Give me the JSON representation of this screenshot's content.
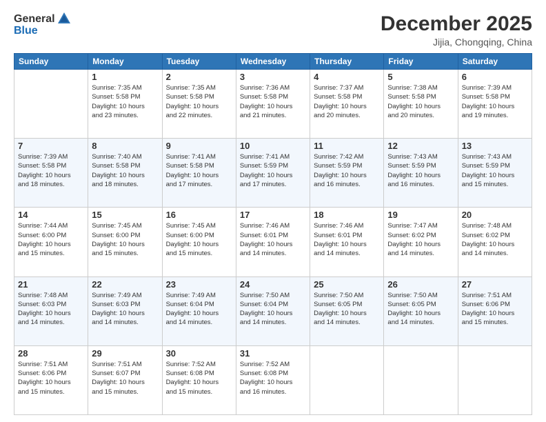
{
  "header": {
    "logo_general": "General",
    "logo_blue": "Blue",
    "month": "December 2025",
    "location": "Jijia, Chongqing, China"
  },
  "days_of_week": [
    "Sunday",
    "Monday",
    "Tuesday",
    "Wednesday",
    "Thursday",
    "Friday",
    "Saturday"
  ],
  "weeks": [
    [
      {
        "day": "",
        "info": ""
      },
      {
        "day": "1",
        "info": "Sunrise: 7:35 AM\nSunset: 5:58 PM\nDaylight: 10 hours\nand 23 minutes."
      },
      {
        "day": "2",
        "info": "Sunrise: 7:35 AM\nSunset: 5:58 PM\nDaylight: 10 hours\nand 22 minutes."
      },
      {
        "day": "3",
        "info": "Sunrise: 7:36 AM\nSunset: 5:58 PM\nDaylight: 10 hours\nand 21 minutes."
      },
      {
        "day": "4",
        "info": "Sunrise: 7:37 AM\nSunset: 5:58 PM\nDaylight: 10 hours\nand 20 minutes."
      },
      {
        "day": "5",
        "info": "Sunrise: 7:38 AM\nSunset: 5:58 PM\nDaylight: 10 hours\nand 20 minutes."
      },
      {
        "day": "6",
        "info": "Sunrise: 7:39 AM\nSunset: 5:58 PM\nDaylight: 10 hours\nand 19 minutes."
      }
    ],
    [
      {
        "day": "7",
        "info": "Sunrise: 7:39 AM\nSunset: 5:58 PM\nDaylight: 10 hours\nand 18 minutes."
      },
      {
        "day": "8",
        "info": "Sunrise: 7:40 AM\nSunset: 5:58 PM\nDaylight: 10 hours\nand 18 minutes."
      },
      {
        "day": "9",
        "info": "Sunrise: 7:41 AM\nSunset: 5:58 PM\nDaylight: 10 hours\nand 17 minutes."
      },
      {
        "day": "10",
        "info": "Sunrise: 7:41 AM\nSunset: 5:59 PM\nDaylight: 10 hours\nand 17 minutes."
      },
      {
        "day": "11",
        "info": "Sunrise: 7:42 AM\nSunset: 5:59 PM\nDaylight: 10 hours\nand 16 minutes."
      },
      {
        "day": "12",
        "info": "Sunrise: 7:43 AM\nSunset: 5:59 PM\nDaylight: 10 hours\nand 16 minutes."
      },
      {
        "day": "13",
        "info": "Sunrise: 7:43 AM\nSunset: 5:59 PM\nDaylight: 10 hours\nand 15 minutes."
      }
    ],
    [
      {
        "day": "14",
        "info": "Sunrise: 7:44 AM\nSunset: 6:00 PM\nDaylight: 10 hours\nand 15 minutes."
      },
      {
        "day": "15",
        "info": "Sunrise: 7:45 AM\nSunset: 6:00 PM\nDaylight: 10 hours\nand 15 minutes."
      },
      {
        "day": "16",
        "info": "Sunrise: 7:45 AM\nSunset: 6:00 PM\nDaylight: 10 hours\nand 15 minutes."
      },
      {
        "day": "17",
        "info": "Sunrise: 7:46 AM\nSunset: 6:01 PM\nDaylight: 10 hours\nand 14 minutes."
      },
      {
        "day": "18",
        "info": "Sunrise: 7:46 AM\nSunset: 6:01 PM\nDaylight: 10 hours\nand 14 minutes."
      },
      {
        "day": "19",
        "info": "Sunrise: 7:47 AM\nSunset: 6:02 PM\nDaylight: 10 hours\nand 14 minutes."
      },
      {
        "day": "20",
        "info": "Sunrise: 7:48 AM\nSunset: 6:02 PM\nDaylight: 10 hours\nand 14 minutes."
      }
    ],
    [
      {
        "day": "21",
        "info": "Sunrise: 7:48 AM\nSunset: 6:03 PM\nDaylight: 10 hours\nand 14 minutes."
      },
      {
        "day": "22",
        "info": "Sunrise: 7:49 AM\nSunset: 6:03 PM\nDaylight: 10 hours\nand 14 minutes."
      },
      {
        "day": "23",
        "info": "Sunrise: 7:49 AM\nSunset: 6:04 PM\nDaylight: 10 hours\nand 14 minutes."
      },
      {
        "day": "24",
        "info": "Sunrise: 7:50 AM\nSunset: 6:04 PM\nDaylight: 10 hours\nand 14 minutes."
      },
      {
        "day": "25",
        "info": "Sunrise: 7:50 AM\nSunset: 6:05 PM\nDaylight: 10 hours\nand 14 minutes."
      },
      {
        "day": "26",
        "info": "Sunrise: 7:50 AM\nSunset: 6:05 PM\nDaylight: 10 hours\nand 14 minutes."
      },
      {
        "day": "27",
        "info": "Sunrise: 7:51 AM\nSunset: 6:06 PM\nDaylight: 10 hours\nand 15 minutes."
      }
    ],
    [
      {
        "day": "28",
        "info": "Sunrise: 7:51 AM\nSunset: 6:06 PM\nDaylight: 10 hours\nand 15 minutes."
      },
      {
        "day": "29",
        "info": "Sunrise: 7:51 AM\nSunset: 6:07 PM\nDaylight: 10 hours\nand 15 minutes."
      },
      {
        "day": "30",
        "info": "Sunrise: 7:52 AM\nSunset: 6:08 PM\nDaylight: 10 hours\nand 15 minutes."
      },
      {
        "day": "31",
        "info": "Sunrise: 7:52 AM\nSunset: 6:08 PM\nDaylight: 10 hours\nand 16 minutes."
      },
      {
        "day": "",
        "info": ""
      },
      {
        "day": "",
        "info": ""
      },
      {
        "day": "",
        "info": ""
      }
    ]
  ]
}
